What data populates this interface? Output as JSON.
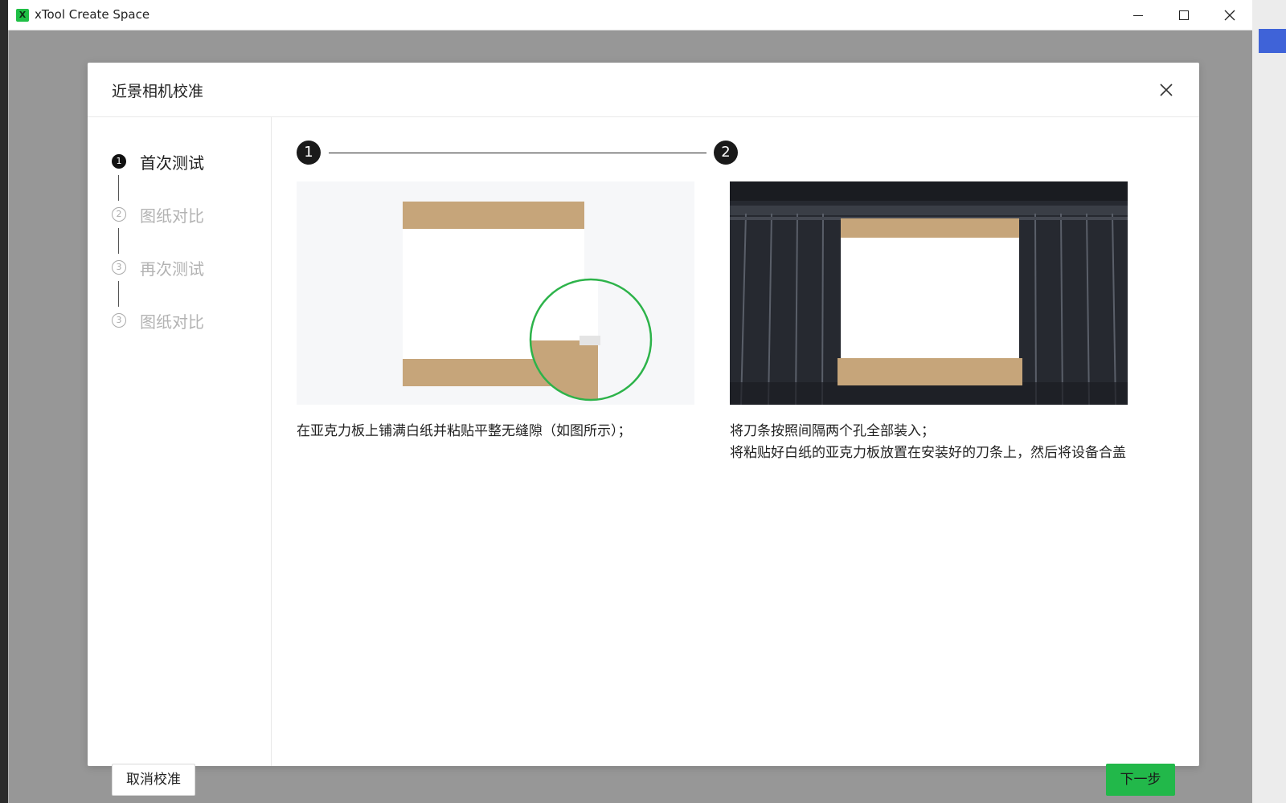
{
  "window": {
    "title": "xTool Create Space",
    "logo": "X"
  },
  "dialog": {
    "title": "近景相机校准",
    "steps": [
      {
        "num": "1",
        "label": "首次测试",
        "active": true
      },
      {
        "num": "2",
        "label": "图纸对比",
        "active": false
      },
      {
        "num": "3",
        "label": "再次测试",
        "active": false
      },
      {
        "num": "3",
        "label": "图纸对比",
        "active": false
      }
    ],
    "progress": {
      "dot1": "1",
      "dot2": "2"
    },
    "panels": [
      {
        "caption": "在亚克力板上铺满白纸并粘贴平整无缝隙（如图所示）；"
      },
      {
        "caption_line1": "将刀条按照间隔两个孔全部装入；",
        "caption_line2": "将粘贴好白纸的亚克力板放置在安装好的刀条上，然后将设备合盖"
      }
    ],
    "cancel_label": "取消校准",
    "next_label": "下一步"
  },
  "colors": {
    "accent_green": "#22b84a",
    "step_active": "#111111",
    "step_inactive": "#b3b3b3",
    "kraft": "#c6a57a"
  },
  "icons": {
    "close": "close-icon",
    "minimize": "minimize-icon",
    "maximize": "maximize-icon"
  }
}
